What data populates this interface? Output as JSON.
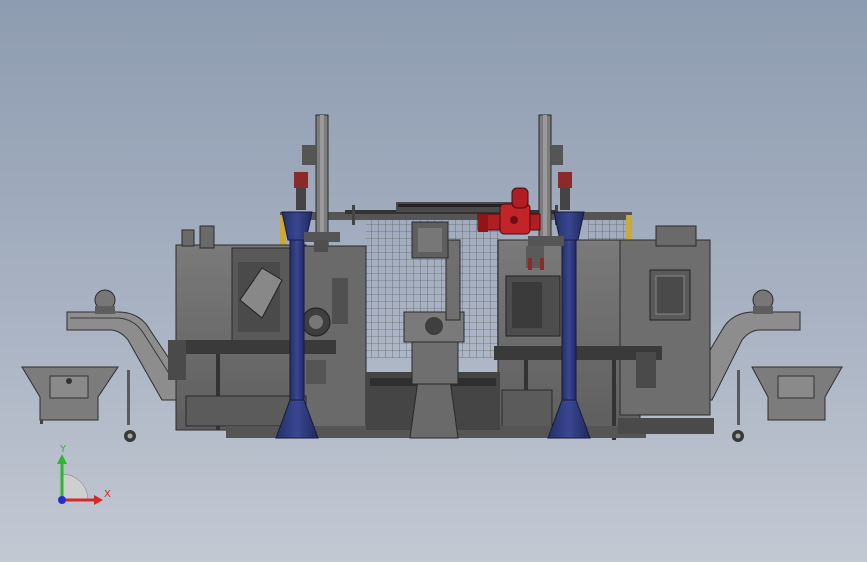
{
  "view": {
    "background_top": "#8e9cb1",
    "background_bottom": "#c3c9d3"
  },
  "colors": {
    "machine_body": "#6e6e6e",
    "machine_dark": "#3c3c3c",
    "gantry_blue": "#2f3a7a",
    "gantry_dark": "#1c2350",
    "gripper_red": "#b01e23",
    "fence_yellow": "#c9a93a",
    "accent_red": "#8b2a2a"
  },
  "triad": {
    "y_label": "Y",
    "x_label": "X",
    "y_color": "#2fb52f",
    "x_color": "#d22a2a",
    "z_color": "#2a2ad2"
  },
  "parts": [
    "left-chip-conveyor",
    "left-cnc-lathe",
    "left-gantry-column",
    "safety-fence",
    "central-robot",
    "red-gripper",
    "right-gantry-column",
    "right-cnc-lathe",
    "right-chip-conveyor"
  ]
}
